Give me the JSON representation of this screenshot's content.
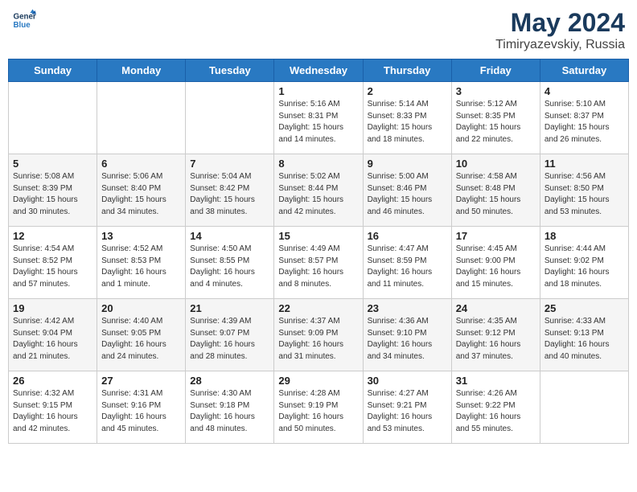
{
  "header": {
    "logo_line1": "General",
    "logo_line2": "Blue",
    "month_year": "May 2024",
    "location": "Timiryazevskiy, Russia"
  },
  "weekdays": [
    "Sunday",
    "Monday",
    "Tuesday",
    "Wednesday",
    "Thursday",
    "Friday",
    "Saturday"
  ],
  "weeks": [
    [
      {
        "day": "",
        "info": ""
      },
      {
        "day": "",
        "info": ""
      },
      {
        "day": "",
        "info": ""
      },
      {
        "day": "1",
        "info": "Sunrise: 5:16 AM\nSunset: 8:31 PM\nDaylight: 15 hours\nand 14 minutes."
      },
      {
        "day": "2",
        "info": "Sunrise: 5:14 AM\nSunset: 8:33 PM\nDaylight: 15 hours\nand 18 minutes."
      },
      {
        "day": "3",
        "info": "Sunrise: 5:12 AM\nSunset: 8:35 PM\nDaylight: 15 hours\nand 22 minutes."
      },
      {
        "day": "4",
        "info": "Sunrise: 5:10 AM\nSunset: 8:37 PM\nDaylight: 15 hours\nand 26 minutes."
      }
    ],
    [
      {
        "day": "5",
        "info": "Sunrise: 5:08 AM\nSunset: 8:39 PM\nDaylight: 15 hours\nand 30 minutes."
      },
      {
        "day": "6",
        "info": "Sunrise: 5:06 AM\nSunset: 8:40 PM\nDaylight: 15 hours\nand 34 minutes."
      },
      {
        "day": "7",
        "info": "Sunrise: 5:04 AM\nSunset: 8:42 PM\nDaylight: 15 hours\nand 38 minutes."
      },
      {
        "day": "8",
        "info": "Sunrise: 5:02 AM\nSunset: 8:44 PM\nDaylight: 15 hours\nand 42 minutes."
      },
      {
        "day": "9",
        "info": "Sunrise: 5:00 AM\nSunset: 8:46 PM\nDaylight: 15 hours\nand 46 minutes."
      },
      {
        "day": "10",
        "info": "Sunrise: 4:58 AM\nSunset: 8:48 PM\nDaylight: 15 hours\nand 50 minutes."
      },
      {
        "day": "11",
        "info": "Sunrise: 4:56 AM\nSunset: 8:50 PM\nDaylight: 15 hours\nand 53 minutes."
      }
    ],
    [
      {
        "day": "12",
        "info": "Sunrise: 4:54 AM\nSunset: 8:52 PM\nDaylight: 15 hours\nand 57 minutes."
      },
      {
        "day": "13",
        "info": "Sunrise: 4:52 AM\nSunset: 8:53 PM\nDaylight: 16 hours\nand 1 minute."
      },
      {
        "day": "14",
        "info": "Sunrise: 4:50 AM\nSunset: 8:55 PM\nDaylight: 16 hours\nand 4 minutes."
      },
      {
        "day": "15",
        "info": "Sunrise: 4:49 AM\nSunset: 8:57 PM\nDaylight: 16 hours\nand 8 minutes."
      },
      {
        "day": "16",
        "info": "Sunrise: 4:47 AM\nSunset: 8:59 PM\nDaylight: 16 hours\nand 11 minutes."
      },
      {
        "day": "17",
        "info": "Sunrise: 4:45 AM\nSunset: 9:00 PM\nDaylight: 16 hours\nand 15 minutes."
      },
      {
        "day": "18",
        "info": "Sunrise: 4:44 AM\nSunset: 9:02 PM\nDaylight: 16 hours\nand 18 minutes."
      }
    ],
    [
      {
        "day": "19",
        "info": "Sunrise: 4:42 AM\nSunset: 9:04 PM\nDaylight: 16 hours\nand 21 minutes."
      },
      {
        "day": "20",
        "info": "Sunrise: 4:40 AM\nSunset: 9:05 PM\nDaylight: 16 hours\nand 24 minutes."
      },
      {
        "day": "21",
        "info": "Sunrise: 4:39 AM\nSunset: 9:07 PM\nDaylight: 16 hours\nand 28 minutes."
      },
      {
        "day": "22",
        "info": "Sunrise: 4:37 AM\nSunset: 9:09 PM\nDaylight: 16 hours\nand 31 minutes."
      },
      {
        "day": "23",
        "info": "Sunrise: 4:36 AM\nSunset: 9:10 PM\nDaylight: 16 hours\nand 34 minutes."
      },
      {
        "day": "24",
        "info": "Sunrise: 4:35 AM\nSunset: 9:12 PM\nDaylight: 16 hours\nand 37 minutes."
      },
      {
        "day": "25",
        "info": "Sunrise: 4:33 AM\nSunset: 9:13 PM\nDaylight: 16 hours\nand 40 minutes."
      }
    ],
    [
      {
        "day": "26",
        "info": "Sunrise: 4:32 AM\nSunset: 9:15 PM\nDaylight: 16 hours\nand 42 minutes."
      },
      {
        "day": "27",
        "info": "Sunrise: 4:31 AM\nSunset: 9:16 PM\nDaylight: 16 hours\nand 45 minutes."
      },
      {
        "day": "28",
        "info": "Sunrise: 4:30 AM\nSunset: 9:18 PM\nDaylight: 16 hours\nand 48 minutes."
      },
      {
        "day": "29",
        "info": "Sunrise: 4:28 AM\nSunset: 9:19 PM\nDaylight: 16 hours\nand 50 minutes."
      },
      {
        "day": "30",
        "info": "Sunrise: 4:27 AM\nSunset: 9:21 PM\nDaylight: 16 hours\nand 53 minutes."
      },
      {
        "day": "31",
        "info": "Sunrise: 4:26 AM\nSunset: 9:22 PM\nDaylight: 16 hours\nand 55 minutes."
      },
      {
        "day": "",
        "info": ""
      }
    ]
  ]
}
